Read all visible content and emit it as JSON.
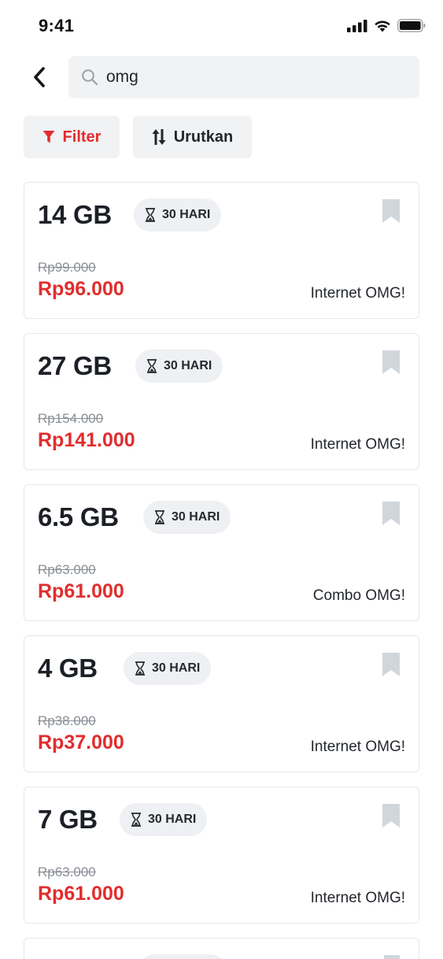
{
  "status_bar": {
    "time": "9:41"
  },
  "search": {
    "value": "omg",
    "placeholder": ""
  },
  "toolbar": {
    "filter_label": "Filter",
    "sort_label": "Urutkan"
  },
  "colors": {
    "accent": "#e12d2d",
    "surface": "#f1f2f4",
    "bookmark": "#d1d6dc"
  },
  "products": [
    {
      "quota": "14 GB",
      "duration": "30 HARI",
      "old_price": "Rp99.000",
      "price": "Rp96.000",
      "name": "Internet OMG!"
    },
    {
      "quota": "27 GB",
      "duration": "30 HARI",
      "old_price": "Rp154.000",
      "price": "Rp141.000",
      "name": "Internet OMG!"
    },
    {
      "quota": "6.5 GB",
      "duration": "30 HARI",
      "old_price": "Rp63.000",
      "price": "Rp61.000",
      "name": "Combo OMG!"
    },
    {
      "quota": "4 GB",
      "duration": "30 HARI",
      "old_price": "Rp38.000",
      "price": "Rp37.000",
      "name": "Internet OMG!"
    },
    {
      "quota": "7 GB",
      "duration": "30 HARI",
      "old_price": "Rp63.000",
      "price": "Rp61.000",
      "name": "Internet OMG!"
    }
  ]
}
